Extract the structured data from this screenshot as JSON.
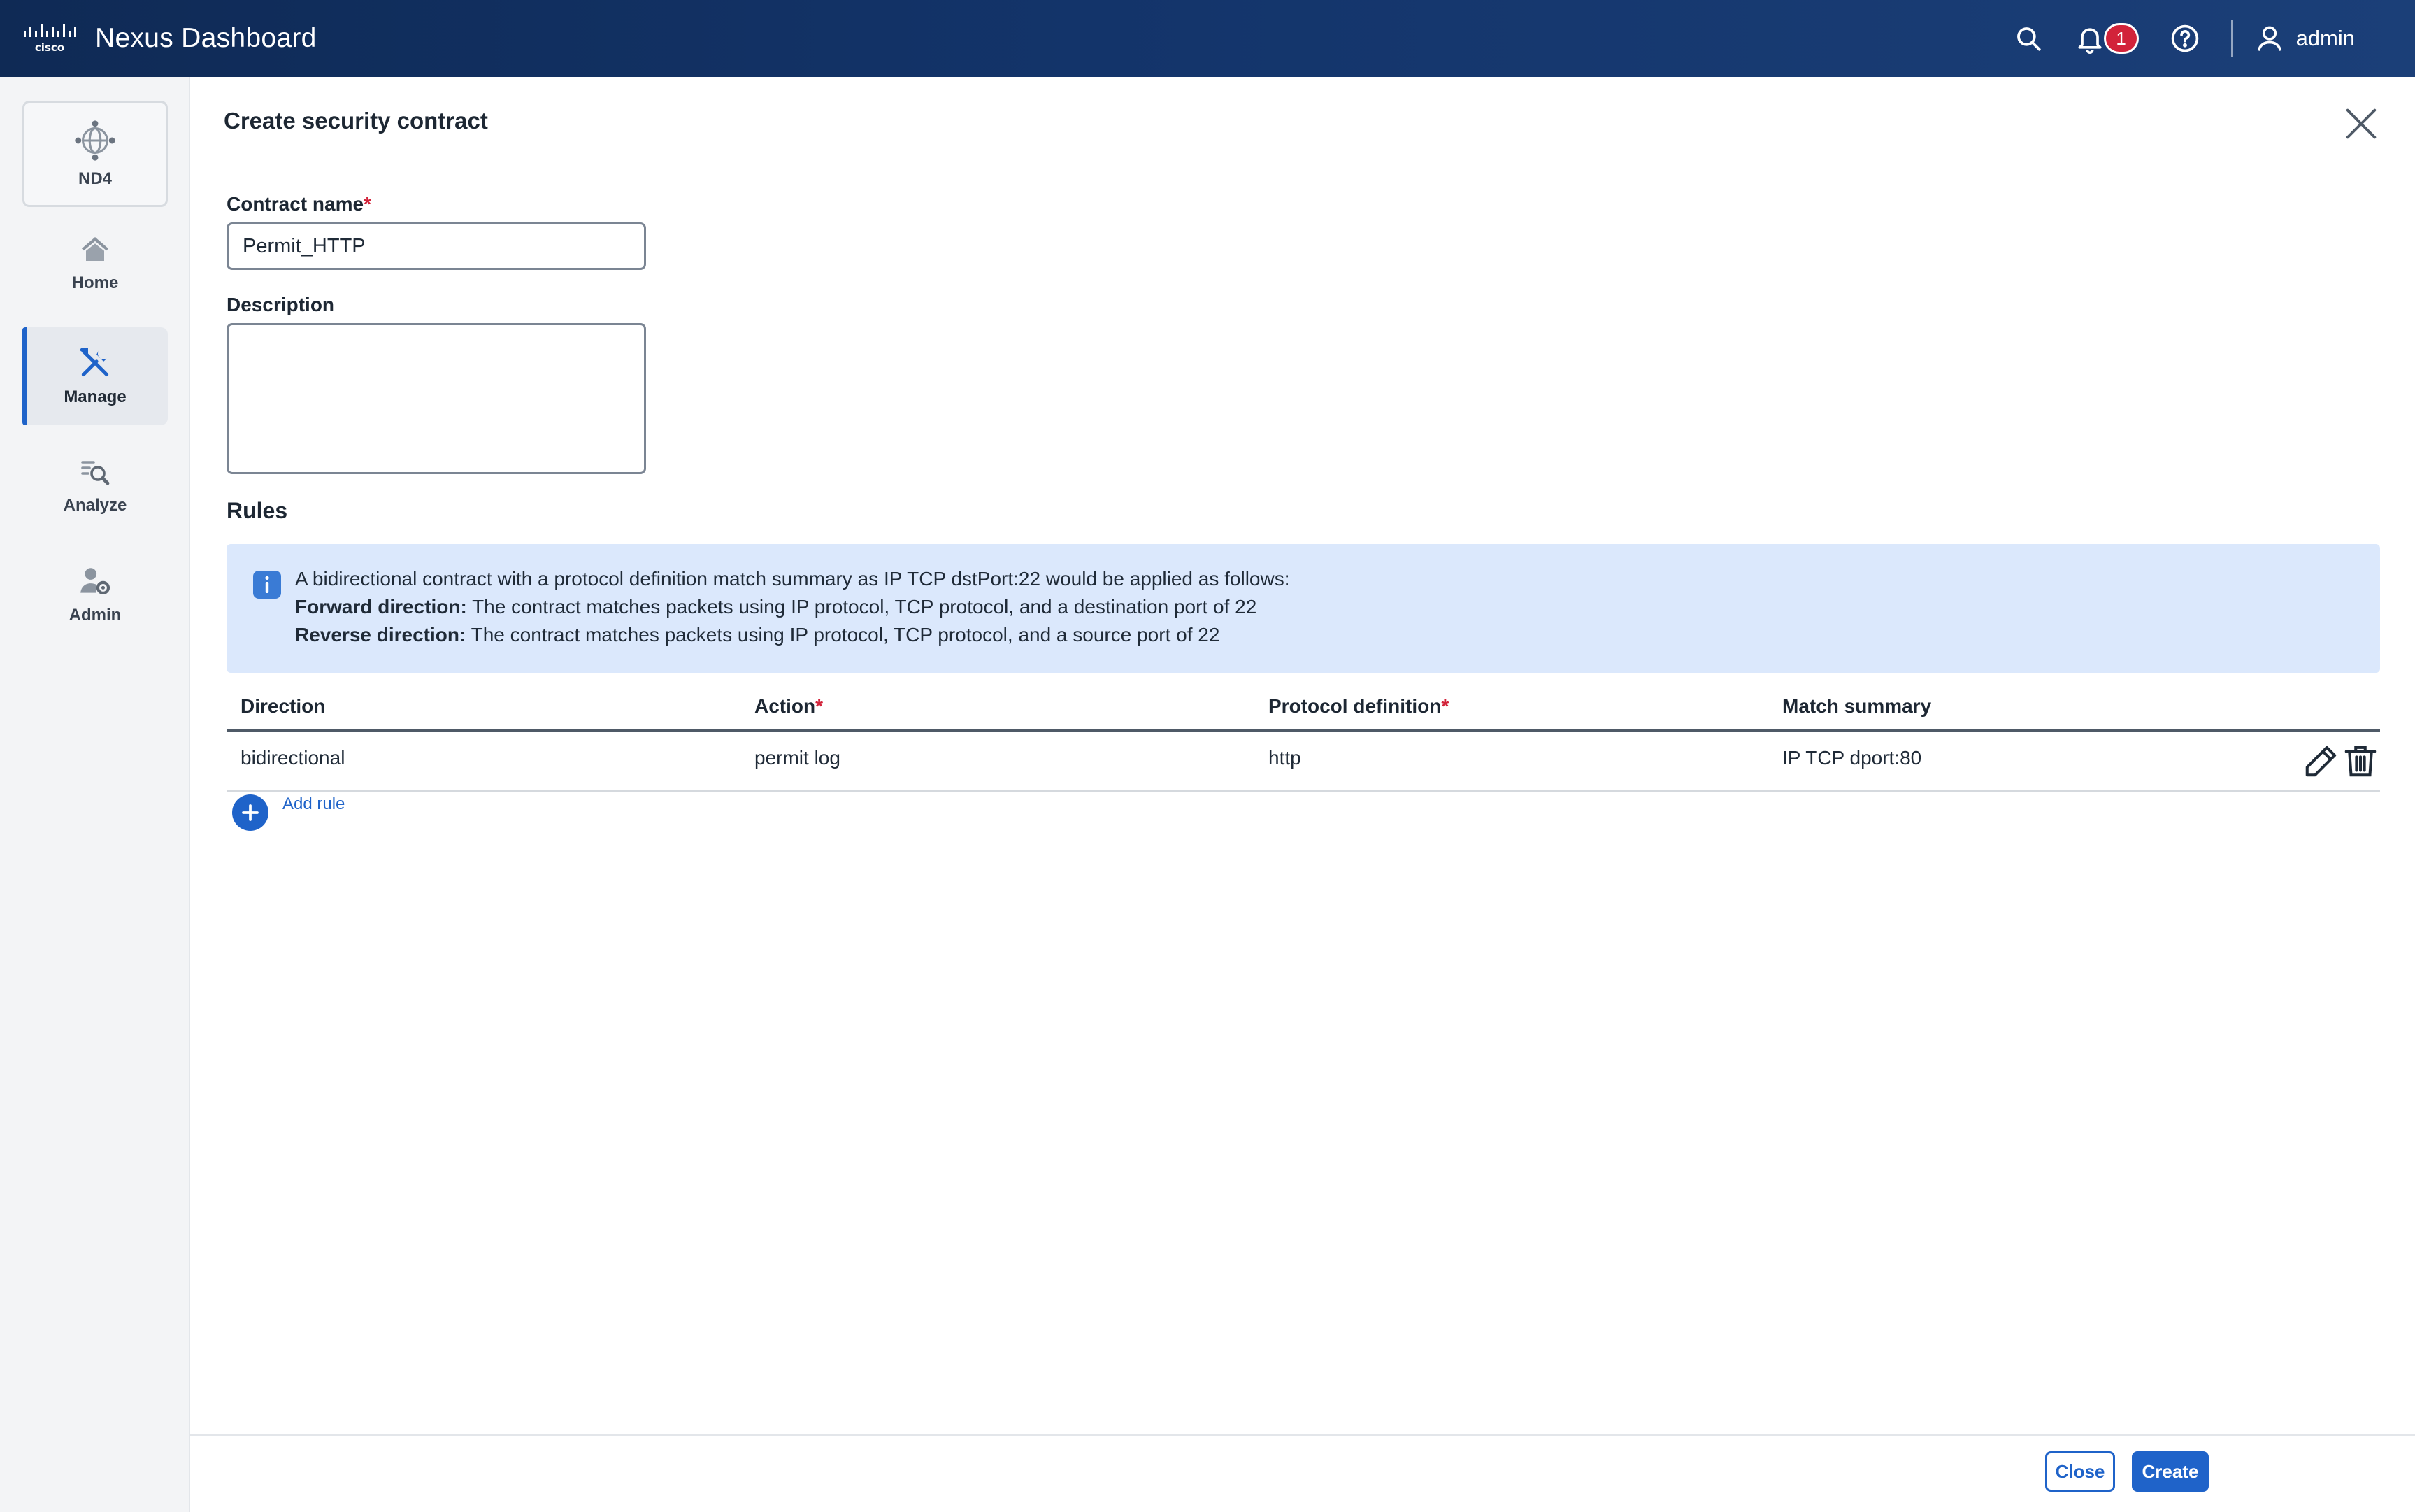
{
  "header": {
    "app_title": "Nexus Dashboard",
    "brand_logo": "cisco",
    "notification_count": "1",
    "user_name": "admin",
    "icons": [
      "search-icon",
      "bell-icon",
      "help-icon",
      "user-icon"
    ]
  },
  "sidebar": {
    "items": [
      {
        "label": "ND4",
        "icon": "nd4-globe-icon"
      },
      {
        "label": "Home",
        "icon": "home-icon"
      },
      {
        "label": "Manage",
        "icon": "tools-icon",
        "active": true
      },
      {
        "label": "Analyze",
        "icon": "analyze-icon"
      },
      {
        "label": "Admin",
        "icon": "admin-gear-user-icon"
      }
    ]
  },
  "form": {
    "title": "Create security contract",
    "contract_name_label": "Contract name",
    "required_mark": "*",
    "contract_name_value": "Permit_HTTP",
    "description_label": "Description",
    "description_value": ""
  },
  "rules": {
    "heading": "Rules",
    "info": {
      "line1": "A bidirectional contract with a protocol definition match summary as IP TCP dstPort:22 would be applied as follows:",
      "forward_label": "Forward direction:",
      "forward_text": " The contract matches packets using IP protocol, TCP protocol, and a destination port of 22",
      "reverse_label": "Reverse direction:",
      "reverse_text": " The contract matches packets using IP protocol, TCP protocol, and a source port of 22"
    },
    "columns": {
      "direction": "Direction",
      "action": "Action",
      "protocol": "Protocol definition",
      "match": "Match summary"
    },
    "rows": [
      {
        "direction": "bidirectional",
        "action": "permit log",
        "protocol": "http",
        "match": "IP TCP dport:80"
      }
    ],
    "add_rule_label": "Add rule"
  },
  "footer": {
    "close_label": "Close",
    "create_label": "Create"
  },
  "colors": {
    "header_bg": "#13346a",
    "accent": "#1f63c9",
    "required": "#d2233a",
    "info_bg": "#dbe8fc"
  }
}
